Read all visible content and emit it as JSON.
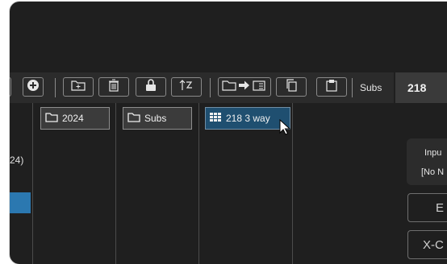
{
  "toolbar": {
    "subs_label": "Subs",
    "buttons": [
      {
        "icon": "add-circle-icon"
      },
      {
        "icon": "new-folder-icon"
      },
      {
        "icon": "trash-icon"
      },
      {
        "icon": "lock-icon"
      },
      {
        "icon": "sort-icon"
      },
      {
        "icon": "move-to-folder-icon"
      },
      {
        "icon": "copy-icon"
      },
      {
        "icon": "clipboard-icon"
      }
    ]
  },
  "right_panel": {
    "title": "218",
    "card_line1": "Inpu",
    "card_line2": "[No N",
    "button1_label": "E",
    "button2_label": "X-C"
  },
  "left_partial_text": "24)",
  "columns": [
    {
      "label": "2024",
      "icon": "folder-icon"
    },
    {
      "label": "Subs",
      "icon": "folder-icon"
    },
    {
      "label": "218  3 way",
      "icon": "grid-icon",
      "selected": true
    }
  ],
  "colors": {
    "background": "#1f1f1f",
    "toolbar": "#2b2b2b",
    "selection": "#1f4f70",
    "accent": "#2b78b0"
  }
}
